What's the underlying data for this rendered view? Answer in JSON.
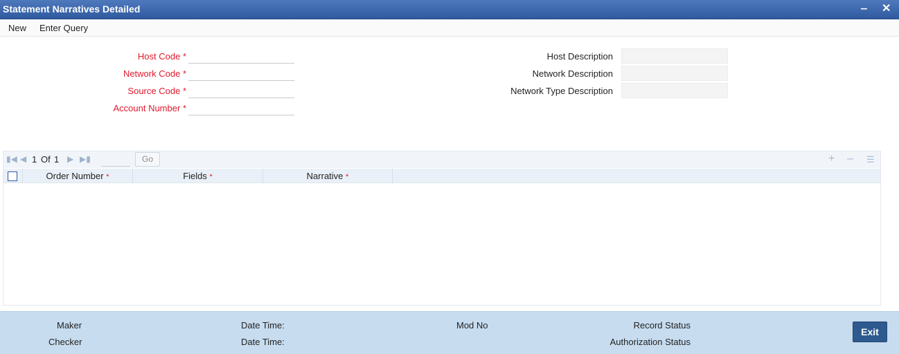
{
  "window": {
    "title": "Statement Narratives Detailed",
    "minimize_glyph": "‒",
    "close_glyph": "✕"
  },
  "menu": {
    "new_label": "New",
    "enter_query_label": "Enter Query"
  },
  "form": {
    "host_code": {
      "label": "Host Code",
      "required_mark": "*",
      "value": ""
    },
    "network_code": {
      "label": "Network Code",
      "required_mark": "*",
      "value": ""
    },
    "source_code": {
      "label": "Source Code",
      "required_mark": "*",
      "value": ""
    },
    "account_number": {
      "label": "Account Number",
      "required_mark": "*",
      "value": ""
    },
    "host_description": {
      "label": "Host Description",
      "value": ""
    },
    "network_description": {
      "label": "Network Description",
      "value": ""
    },
    "network_type_description": {
      "label": "Network Type Description",
      "value": ""
    }
  },
  "grid": {
    "pager": {
      "current_page": "1",
      "of_label": "Of",
      "total_pages": "1",
      "page_input": "",
      "go_label": "Go"
    },
    "icons": {
      "first": "first-page-icon",
      "prev": "prev-page-icon",
      "next": "next-page-icon",
      "last": "last-page-icon",
      "add": "add-row-icon",
      "delete": "delete-row-icon",
      "view": "single-view-icon"
    },
    "columns": [
      {
        "label": "Order Number",
        "required_mark": "*"
      },
      {
        "label": "Fields",
        "required_mark": "*"
      },
      {
        "label": "Narrative",
        "required_mark": "*"
      }
    ],
    "rows": []
  },
  "footer": {
    "maker_label": "Maker",
    "checker_label": "Checker",
    "date_time_label_1": "Date Time:",
    "date_time_label_2": "Date Time:",
    "mod_no_label": "Mod No",
    "record_status_label": "Record Status",
    "authorization_status_label": "Authorization Status",
    "exit_label": "Exit"
  },
  "colors": {
    "title_bar": "#3b65ab",
    "required": "#e0182d",
    "footer_bg": "#c7dcef",
    "exit_button": "#2e5a8f"
  }
}
